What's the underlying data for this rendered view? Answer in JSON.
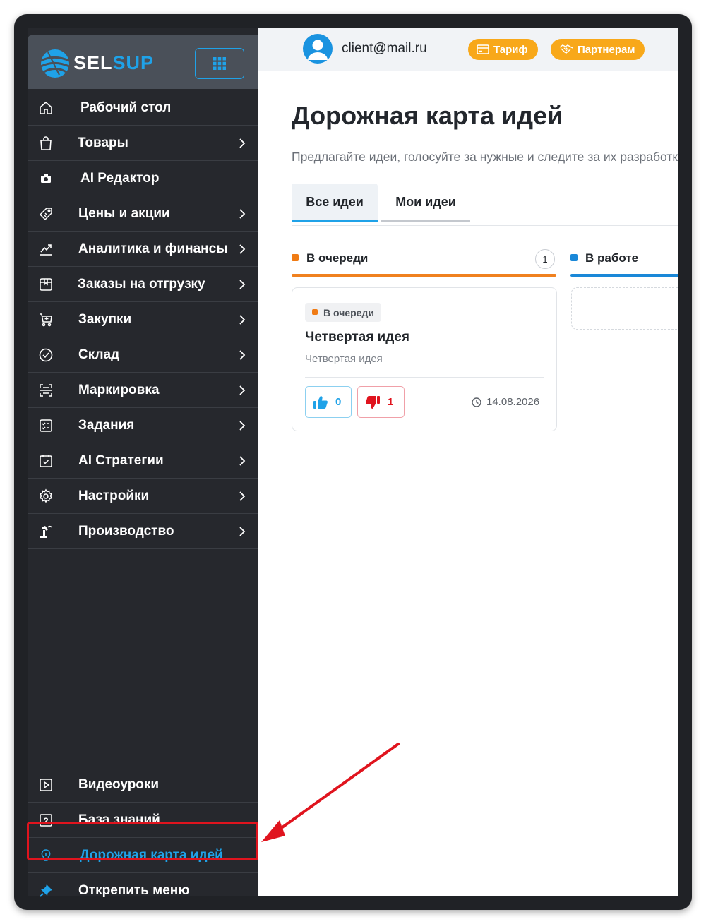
{
  "brand": {
    "logo_sel": "SEL",
    "logo_sup": "SUP"
  },
  "sidebar": {
    "items": [
      {
        "label": "Рабочий стол"
      },
      {
        "label": "Товары"
      },
      {
        "label": "AI Редактор"
      },
      {
        "label": "Цены и акции"
      },
      {
        "label": "Аналитика и финансы"
      },
      {
        "label": "Заказы на отгрузку"
      },
      {
        "label": "Закупки"
      },
      {
        "label": "Склад"
      },
      {
        "label": "Маркировка"
      },
      {
        "label": "Задания"
      },
      {
        "label": "AI Стратегии"
      },
      {
        "label": "Настройки"
      },
      {
        "label": "Производство"
      }
    ],
    "bottom_items": [
      {
        "label": "Видеоуроки"
      },
      {
        "label": "База знаний"
      },
      {
        "label": "Дорожная карта идей"
      },
      {
        "label": "Открепить меню"
      }
    ]
  },
  "header": {
    "email": "client@mail.ru",
    "tariff_label": "Тариф",
    "partners_label": "Партнерам"
  },
  "page": {
    "title": "Дорожная карта идей",
    "subtitle": "Предлагайте идеи, голосуйте за нужные и следите за их разработкой"
  },
  "tabs": [
    {
      "label": "Все идеи"
    },
    {
      "label": "Мои идеи"
    }
  ],
  "columns": [
    {
      "name": "В очереди",
      "count": "1"
    },
    {
      "name": "В работе"
    }
  ],
  "card": {
    "status": "В очереди",
    "title": "Четвертая идея",
    "description": "Четвертая идея",
    "likes": "0",
    "dislikes": "1",
    "date": "14.08.2026"
  },
  "colors": {
    "accent": "#1fa2e8",
    "queue": "#f07b14",
    "dislike": "#e0141e",
    "pill": "#f8a81a",
    "sidebar_bg": "#26282d"
  }
}
